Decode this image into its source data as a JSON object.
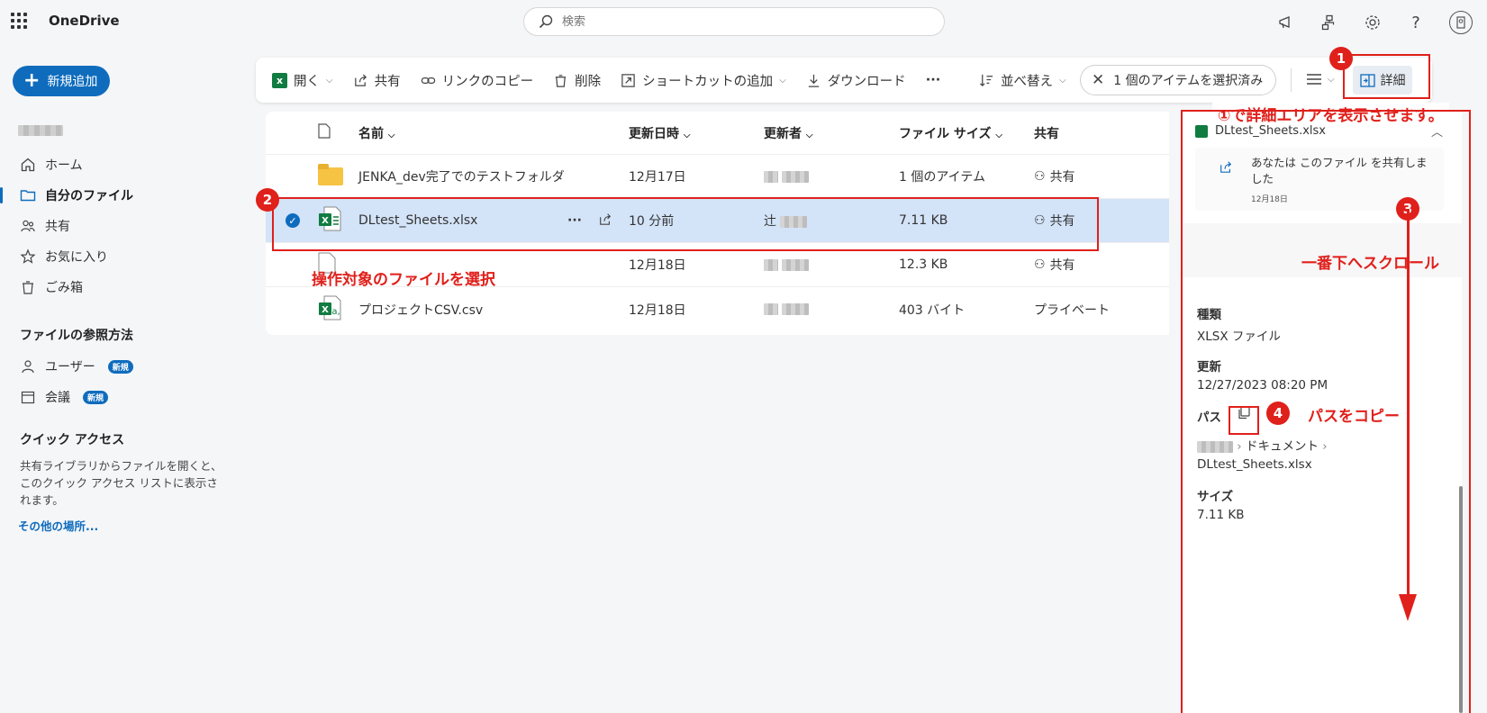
{
  "app": {
    "name": "OneDrive"
  },
  "search": {
    "placeholder": "検索"
  },
  "new_button": {
    "label": "新規追加"
  },
  "nav": {
    "items": [
      {
        "label": "ホーム",
        "icon": "home-icon"
      },
      {
        "label": "自分のファイル",
        "icon": "folder-icon",
        "active": true
      },
      {
        "label": "共有",
        "icon": "people-icon"
      },
      {
        "label": "お気に入り",
        "icon": "star-icon"
      },
      {
        "label": "ごみ箱",
        "icon": "trash-icon"
      }
    ],
    "browse_heading": "ファイルの参照方法",
    "browse_items": [
      {
        "label": "ユーザー",
        "badge": "新規"
      },
      {
        "label": "会議",
        "badge": "新規"
      }
    ],
    "quick_heading": "クイック アクセス",
    "quick_desc": "共有ライブラリからファイルを開くと、このクイック アクセス リストに表示されます。",
    "more_link": "その他の場所..."
  },
  "toolbar": {
    "open": "開く",
    "share": "共有",
    "copy_link": "リンクのコピー",
    "delete": "削除",
    "add_shortcut": "ショートカットの追加",
    "download": "ダウンロード",
    "more": "···",
    "sort": "並べ替え",
    "selection": "1 個のアイテムを選択済み",
    "details": "詳細"
  },
  "table": {
    "headers": {
      "name": "名前",
      "modified": "更新日時",
      "modified_by": "更新者",
      "size": "ファイル サイズ",
      "sharing": "共有"
    },
    "rows": [
      {
        "name": "JENKA_dev完了でのテストフォルダ",
        "modified": "12月17日",
        "size": "1 個のアイテム",
        "sharing": "共有",
        "type": "folder"
      },
      {
        "name": "DLtest_Sheets.xlsx",
        "modified": "10 分前",
        "size": "7.11 KB",
        "sharing": "共有",
        "type": "xlsx",
        "selected": true
      },
      {
        "name": "",
        "modified": "12月18日",
        "size": "12.3 KB",
        "sharing": "共有",
        "type": "file"
      },
      {
        "name": "プロジェクトCSV.csv",
        "modified": "12月18日",
        "size": "403 バイト",
        "sharing": "プライベート",
        "type": "csv"
      }
    ],
    "selected_user_prefix": "辻"
  },
  "details": {
    "file_title": "DLtest_Sheets.xlsx",
    "activity_text": "あなたは このファイル を共有しました",
    "activity_date": "12月18日",
    "type_label": "種類",
    "type_value": "XLSX ファイル",
    "modified_label": "更新",
    "modified_value": "12/27/2023 08:20 PM",
    "path_label": "パス",
    "path_folder": "ドキュメント",
    "path_file": "DLtest_Sheets.xlsx",
    "size_label": "サイズ",
    "size_value": "7.11 KB"
  },
  "annotations": {
    "step1_text": "①で詳細エリアを表示させます。",
    "step2_text": "操作対象のファイルを選択",
    "step3_text": "一番下へスクロール",
    "step4_text": "パスをコピー",
    "n1": "1",
    "n2": "2",
    "n3": "3",
    "n4": "4"
  },
  "colors": {
    "accent": "#0f6cbd",
    "annotation": "#e0201b",
    "excel": "#107c41"
  }
}
